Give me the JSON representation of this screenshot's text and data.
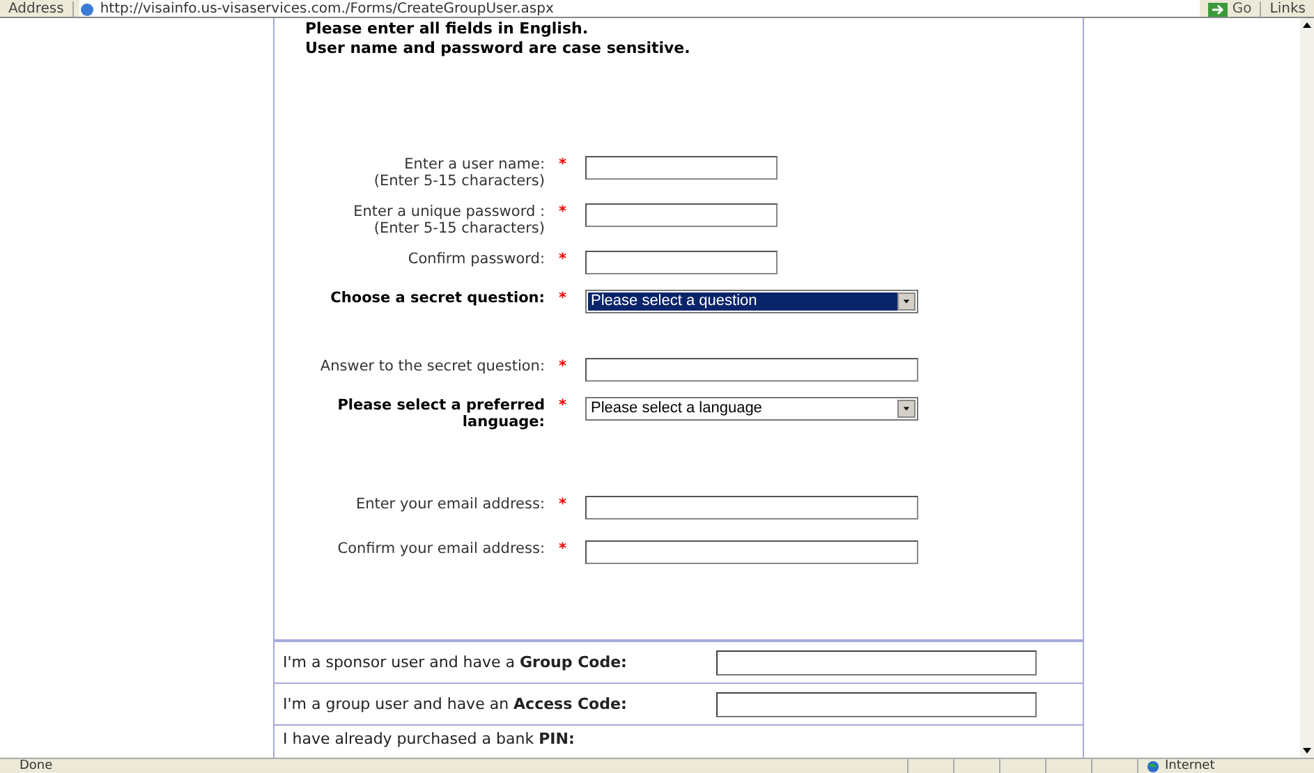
{
  "address_bar": {
    "label": "Address",
    "url": "http://visainfo.us-visaservices.com./Forms/CreateGroupUser.aspx",
    "go": "Go",
    "links": "Links"
  },
  "intro": [
    "Please enter all fields in English.",
    "User name and password are case sensitive."
  ],
  "fields": [
    {
      "kind": "text",
      "label": "Enter a user name:",
      "hint": "(Enter 5-15 characters)",
      "bold": false,
      "required": "*"
    },
    {
      "kind": "text",
      "label": "Enter a unique password :",
      "hint": "(Enter 5-15 characters)",
      "bold": false,
      "required": "*"
    },
    {
      "kind": "text",
      "label": "Confirm password:",
      "bold": false,
      "required": "*"
    },
    {
      "kind": "select",
      "label": "Choose a secret question:",
      "bold": true,
      "required": "*",
      "value": "Please select a question",
      "focused": true
    },
    {
      "kind": "wide",
      "label": "Answer to the secret question:",
      "bold": false,
      "required": "*"
    },
    {
      "kind": "select",
      "label": "Please select a preferred language:",
      "bold": true,
      "required": "*",
      "value": "Please select a language",
      "focused": false
    },
    {
      "kind": "wide",
      "label": "Enter your email address:",
      "bold": false,
      "required": "*"
    },
    {
      "kind": "wide",
      "label": "Confirm your email address:",
      "bold": false,
      "required": "*"
    }
  ],
  "codes": [
    {
      "kind": "input",
      "text": "I'm a sponsor user and have a **Group Code:**"
    },
    {
      "kind": "input",
      "text": "I'm a group user and have an **Access Code:**"
    },
    {
      "kind": "none",
      "text": "I have already purchased a bank **PIN:**"
    }
  ],
  "status_bar": {
    "text": "Done",
    "zone": "Internet"
  }
}
